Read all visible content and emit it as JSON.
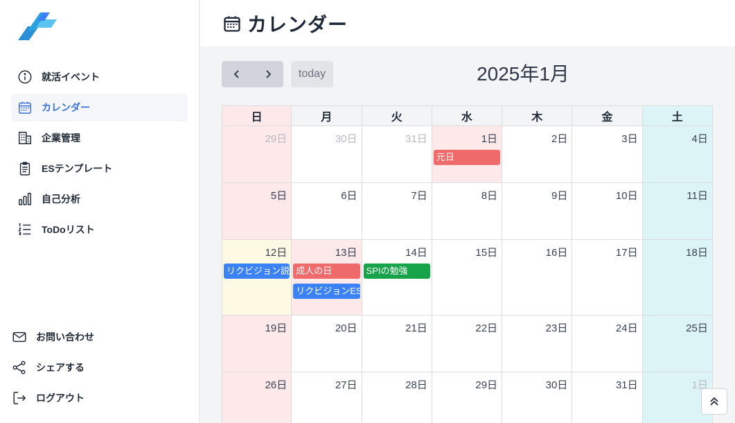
{
  "header": {
    "title": "カレンダー"
  },
  "sidebar": {
    "items": [
      {
        "label": "就活イベント",
        "icon": "info-icon"
      },
      {
        "label": "カレンダー",
        "icon": "calendar-icon",
        "active": true
      },
      {
        "label": "企業管理",
        "icon": "building-icon"
      },
      {
        "label": "ESテンプレート",
        "icon": "clipboard-icon"
      },
      {
        "label": "自己分析",
        "icon": "bar-chart-icon"
      },
      {
        "label": "ToDoリスト",
        "icon": "list-icon"
      }
    ],
    "bottom": [
      {
        "label": "お問い合わせ",
        "icon": "mail-icon"
      },
      {
        "label": "シェアする",
        "icon": "share-icon"
      },
      {
        "label": "ログアウト",
        "icon": "logout-icon"
      }
    ]
  },
  "toolbar": {
    "today": "today",
    "month_title": "2025年1月"
  },
  "calendar": {
    "weekdays": [
      "日",
      "月",
      "火",
      "水",
      "木",
      "金",
      "土"
    ],
    "weeks": [
      {
        "height": 82,
        "days": [
          {
            "label": "29日",
            "other": true
          },
          {
            "label": "30日",
            "other": true
          },
          {
            "label": "31日",
            "other": true
          },
          {
            "label": "1日",
            "holiday": true,
            "events": [
              {
                "title": "元日",
                "color": "#ef6b6b"
              }
            ]
          },
          {
            "label": "2日"
          },
          {
            "label": "3日"
          },
          {
            "label": "4日"
          }
        ]
      },
      {
        "height": 82,
        "days": [
          {
            "label": "5日"
          },
          {
            "label": "6日"
          },
          {
            "label": "7日"
          },
          {
            "label": "8日"
          },
          {
            "label": "9日"
          },
          {
            "label": "10日"
          },
          {
            "label": "11日"
          }
        ]
      },
      {
        "height": 109,
        "days": [
          {
            "label": "12日",
            "today": true,
            "events": [
              {
                "title": "リクビジョン説明会",
                "color": "#3b82f6"
              }
            ]
          },
          {
            "label": "13日",
            "holiday": true,
            "events": [
              {
                "title": "成人の日",
                "color": "#ef6b6b"
              },
              {
                "title": "リクビジョンES締切",
                "color": "#3b82f6"
              }
            ]
          },
          {
            "label": "14日",
            "events": [
              {
                "title": "SPIの勉強",
                "color": "#16a34a"
              }
            ]
          },
          {
            "label": "15日"
          },
          {
            "label": "16日"
          },
          {
            "label": "17日"
          },
          {
            "label": "18日"
          }
        ]
      },
      {
        "height": 82,
        "days": [
          {
            "label": "19日"
          },
          {
            "label": "20日"
          },
          {
            "label": "21日"
          },
          {
            "label": "22日"
          },
          {
            "label": "23日"
          },
          {
            "label": "24日"
          },
          {
            "label": "25日"
          }
        ]
      },
      {
        "height": 82,
        "days": [
          {
            "label": "26日"
          },
          {
            "label": "27日"
          },
          {
            "label": "28日"
          },
          {
            "label": "29日"
          },
          {
            "label": "30日"
          },
          {
            "label": "31日"
          },
          {
            "label": "1日",
            "other": true
          }
        ]
      }
    ]
  }
}
